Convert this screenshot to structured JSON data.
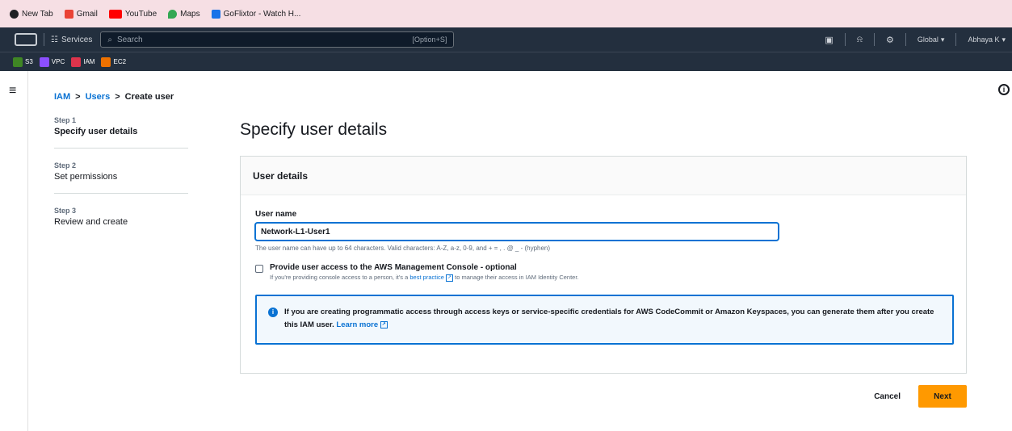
{
  "browser": {
    "bookmarks": [
      {
        "label": "New Tab",
        "icon": "globe-icon",
        "color": "#202124"
      },
      {
        "label": "Gmail",
        "icon": "gmail-icon",
        "color": "#ea4335"
      },
      {
        "label": "YouTube",
        "icon": "youtube-icon",
        "color": "#ff0000"
      },
      {
        "label": "Maps",
        "icon": "maps-icon",
        "color": "#34a853"
      },
      {
        "label": "GoFlixtor - Watch H...",
        "icon": "bookmark-icon",
        "color": "#1a73e8"
      }
    ]
  },
  "aws_nav": {
    "services": "Services",
    "search_placeholder": "Search",
    "search_shortcut": "[Option+S]",
    "region": "Global",
    "account": "Abhaya K"
  },
  "favorites": [
    {
      "label": "S3",
      "color": "#3f8624"
    },
    {
      "label": "VPC",
      "color": "#8c4fff"
    },
    {
      "label": "IAM",
      "color": "#dd344c"
    },
    {
      "label": "EC2",
      "color": "#ed7100"
    }
  ],
  "breadcrumb": {
    "iam": "IAM",
    "users": "Users",
    "current": "Create user",
    "separator": ">"
  },
  "steps": [
    {
      "num": "Step 1",
      "title": "Specify user details",
      "active": true
    },
    {
      "num": "Step 2",
      "title": "Set permissions",
      "active": false
    },
    {
      "num": "Step 3",
      "title": "Review and create",
      "active": false
    }
  ],
  "page_title": "Specify user details",
  "card": {
    "title": "User details",
    "username_label": "User name",
    "username_value": "Network-L1-User1",
    "username_hint": "The user name can have up to 64 characters. Valid characters: A-Z, a-z, 0-9, and + = , . @ _ - (hyphen)",
    "console_access_label": "Provide user access to the AWS Management Console - optional",
    "console_desc_pre": "If you're providing console access to a person, it's a",
    "console_desc_link": "best practice",
    "console_desc_post": "to manage their access in IAM Identity Center.",
    "alert_text": "If you are creating programmatic access through access keys or service-specific credentials for AWS CodeCommit or Amazon Keyspaces, you can generate them after you create this IAM user.",
    "alert_link": "Learn more"
  },
  "actions": {
    "cancel": "Cancel",
    "next": "Next"
  },
  "colors": {
    "nav_bg": "#232f3e",
    "primary": "#ff9900",
    "link": "#0972d3"
  }
}
